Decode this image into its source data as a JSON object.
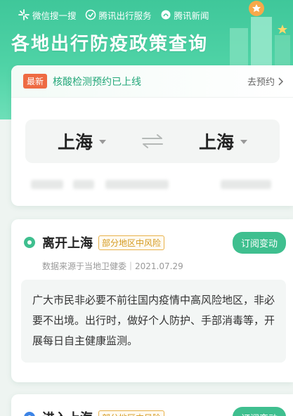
{
  "header": {
    "brands": [
      {
        "icon": "wechat-search-icon",
        "label": "微信搜一搜"
      },
      {
        "icon": "tencent-travel-icon",
        "label": "腾讯出行服务"
      },
      {
        "icon": "tencent-news-icon",
        "label": "腾讯新闻"
      }
    ],
    "title": "各地出行防疫政策查询"
  },
  "notice": {
    "badge": "最新",
    "text": "核酸检测预约已上线",
    "link": "去预约"
  },
  "route": {
    "from": "上海",
    "to": "上海"
  },
  "leave_card": {
    "title": "离开上海",
    "risk": "部分地区中风险",
    "subscribe": "订阅变动",
    "source": "数据来源于当地卫健委｜2021.07.29",
    "policy": "广大市民非必要不前往国内疫情中高风险地区，非必要不出境。出行时，做好个人防护、手部消毒等，开展每日自主健康监测。"
  },
  "enter_card": {
    "title": "进入上海",
    "risk": "部分地区中风险",
    "subscribe": "订阅变动"
  },
  "colors": {
    "accent": "#3fbf8f",
    "badge": "#ee6b43",
    "risk": "#d49a21"
  }
}
